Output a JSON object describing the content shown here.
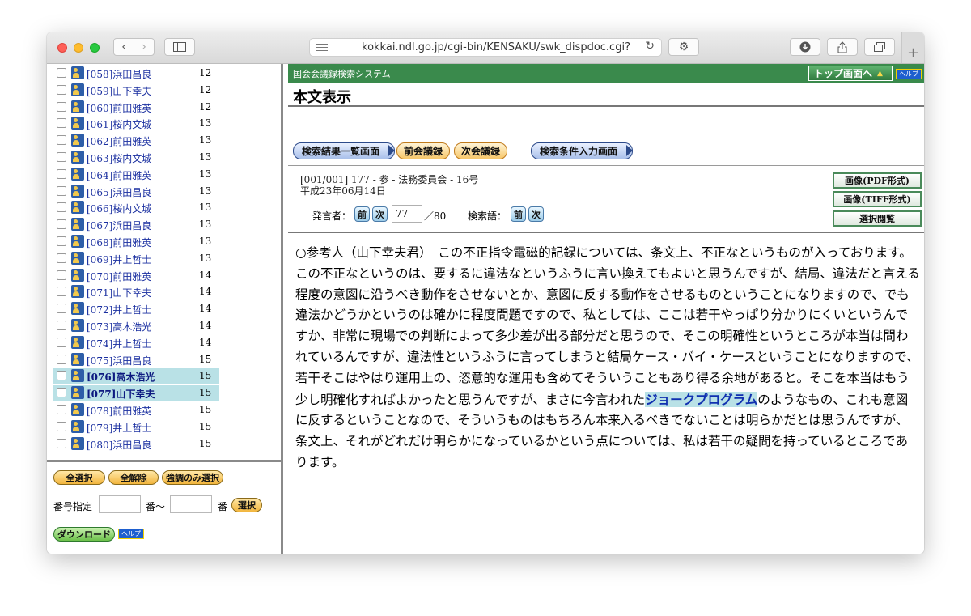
{
  "browser": {
    "url": "kokkai.ndl.go.jp/cgi-bin/KENSAKU/swk_dispdoc.cgi?"
  },
  "speakers": [
    {
      "num": "[058]",
      "name": "浜田昌良",
      "page": "12",
      "selected": false
    },
    {
      "num": "[059]",
      "name": "山下幸夫",
      "page": "12",
      "selected": false
    },
    {
      "num": "[060]",
      "name": "前田雅英",
      "page": "12",
      "selected": false
    },
    {
      "num": "[061]",
      "name": "桜内文城",
      "page": "13",
      "selected": false
    },
    {
      "num": "[062]",
      "name": "前田雅英",
      "page": "13",
      "selected": false
    },
    {
      "num": "[063]",
      "name": "桜内文城",
      "page": "13",
      "selected": false
    },
    {
      "num": "[064]",
      "name": "前田雅英",
      "page": "13",
      "selected": false
    },
    {
      "num": "[065]",
      "name": "浜田昌良",
      "page": "13",
      "selected": false
    },
    {
      "num": "[066]",
      "name": "桜内文城",
      "page": "13",
      "selected": false
    },
    {
      "num": "[067]",
      "name": "浜田昌良",
      "page": "13",
      "selected": false
    },
    {
      "num": "[068]",
      "name": "前田雅英",
      "page": "13",
      "selected": false
    },
    {
      "num": "[069]",
      "name": "井上哲士",
      "page": "13",
      "selected": false
    },
    {
      "num": "[070]",
      "name": "前田雅英",
      "page": "14",
      "selected": false
    },
    {
      "num": "[071]",
      "name": "山下幸夫",
      "page": "14",
      "selected": false
    },
    {
      "num": "[072]",
      "name": "井上哲士",
      "page": "14",
      "selected": false
    },
    {
      "num": "[073]",
      "name": "高木浩光",
      "page": "14",
      "selected": false
    },
    {
      "num": "[074]",
      "name": "井上哲士",
      "page": "14",
      "selected": false
    },
    {
      "num": "[075]",
      "name": "浜田昌良",
      "page": "15",
      "selected": false
    },
    {
      "num": "[076]",
      "name": "高木浩光",
      "page": "15",
      "selected": true
    },
    {
      "num": "[077]",
      "name": "山下幸夫",
      "page": "15",
      "selected": true
    },
    {
      "num": "[078]",
      "name": "前田雅英",
      "page": "15",
      "selected": false
    },
    {
      "num": "[079]",
      "name": "井上哲士",
      "page": "15",
      "selected": false
    },
    {
      "num": "[080]",
      "name": "浜田昌良",
      "page": "15",
      "selected": false
    }
  ],
  "controls": {
    "select_all": "全選択",
    "deselect_all": "全解除",
    "highlight_only": "強調のみ選択",
    "number_spec": "番号指定",
    "from_suffix": "番〜",
    "to_suffix": "番",
    "select_btn": "選択",
    "download": "ダウンロード",
    "help": "ヘルプ"
  },
  "header": {
    "system_name": "国会会議録検索システム",
    "top_btn": "トップ画面へ",
    "help": "ヘルプ",
    "page_title": "本文表示"
  },
  "nav": {
    "results": "検索結果一覧画面",
    "prev_meeting": "前会議録",
    "next_meeting": "次会議録",
    "search_cond": "検索条件入力画面"
  },
  "doc": {
    "meta": "[001/001] 177 - 参 - 法務委員会 - 16号",
    "date": "平成23年06月14日",
    "speaker_label": "発言者：",
    "prev": "前",
    "next": "次",
    "speaker_no": "77",
    "total": "／80",
    "term_label": "検索語：",
    "pdf": "画像(PDF形式)",
    "tiff": "画像(TIFF形式)",
    "browse": "選択閲覧"
  },
  "speech": {
    "before": "○参考人（山下幸夫君）　この不正指令電磁的記録については、条文上、不正なというものが入っております。この不正なというのは、要するに違法なというふうに言い換えてもよいと思うんですが、結局、違法だと言える程度の意図に沿うべき動作をさせないとか、意図に反する動作をさせるものということになりますので、でも違法かどうかというのは確かに程度問題ですので、私としては、ここは若干やっぱり分かりにくいというんですか、非常に現場での判断によって多少差が出る部分だと思うので、そこの明確性というところが本当は問われているんですが、違法性というふうに言ってしまうと結局ケース・バイ・ケースということになりますので、若干そこはやはり運用上の、恣意的な運用も含めてそういうこともあり得る余地があると。そこを本当はもう少し明確化すればよかったと思うんですが、まさに今言われた",
    "highlight": "ジョークプログラム",
    "after": "のようなもの、これも意図に反するということなので、そういうものはもちろん本来入るべきでないことは明らかだとは思うんですが、条文上、それがどれだけ明らかになっているかという点については、私は若干の疑問を持っているところであります。"
  }
}
